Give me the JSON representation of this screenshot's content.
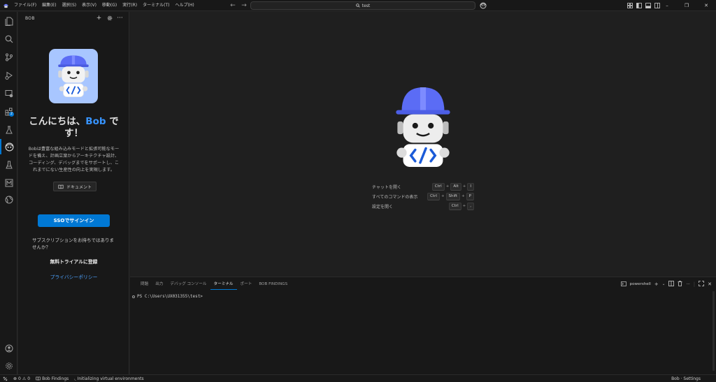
{
  "titlebar": {
    "menu": [
      "ファイル(F)",
      "編集(E)",
      "選択(S)",
      "表示(V)",
      "移動(G)",
      "実行(R)",
      "ターミナル(T)",
      "ヘルプ(H)"
    ],
    "search_text": "test"
  },
  "activity_bar": {
    "extensions_badge": "2"
  },
  "sidebar": {
    "title": "BOB",
    "greeting_prefix": "こんにちは、",
    "greeting_name": "Bob",
    "greeting_suffix": " です！",
    "description": "Bobは豊富な組み込みモードと拡張可能なモードを備え、計画立案からアーキテクチャ設計、コーディング、デバッグまでをサポートし、これまでにない生産性の向上を実現します。",
    "doc_button": "ドキュメント",
    "sso_button": "SSOでサインイン",
    "no_subscription": "サブスクリプションをお持ちではありませんか？",
    "trial_link": "無料トライアルに登録",
    "privacy_link": "プライバシーポリシー"
  },
  "editor": {
    "shortcuts": [
      {
        "label": "チャットを開く",
        "keys": [
          "Ctrl",
          "Alt",
          "I"
        ]
      },
      {
        "label": "すべてのコマンドの表示",
        "keys": [
          "Ctrl",
          "Shift",
          "P"
        ]
      },
      {
        "label": "設定を開く",
        "keys": [
          "Ctrl",
          ","
        ]
      }
    ]
  },
  "panel": {
    "tabs": [
      "問題",
      "出力",
      "デバッグ コンソール",
      "ターミナル",
      "ポート",
      "BOB FINDINGS"
    ],
    "active_tab": "ターミナル",
    "terminal_profile": "powershell",
    "prompt": "PS C:\\Users\\UX031355\\test>"
  },
  "statusbar": {
    "errors": "0",
    "warnings": "0",
    "bob_findings": "Bob Findings",
    "status_message": "Initializing virtual environments",
    "right_label": "Bob · Settings"
  },
  "colors": {
    "accent": "#0078d4",
    "link": "#4da3ff",
    "helmet": "#5b6cf5",
    "hero_bg": "#a8c6ff"
  }
}
